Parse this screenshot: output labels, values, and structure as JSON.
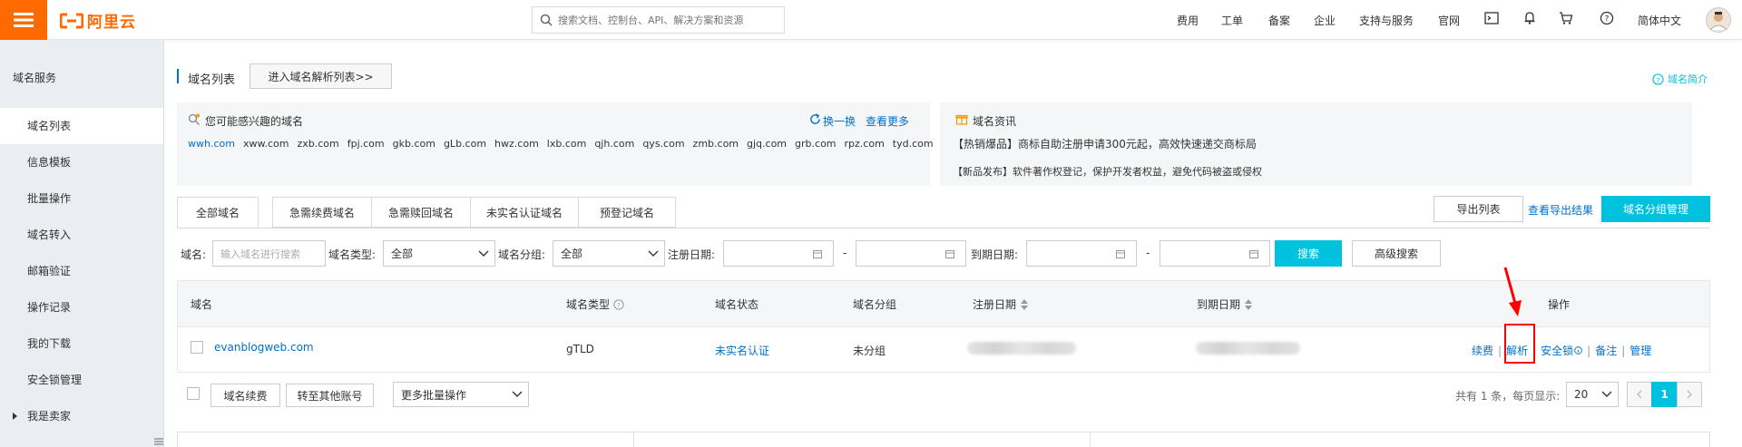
{
  "topbar": {
    "logo_text": "阿里云",
    "search_placeholder": "搜索文档、控制台、API、解决方案和资源",
    "nav": [
      "费用",
      "工单",
      "备案",
      "企业",
      "支持与服务",
      "官网"
    ],
    "language": "简体中文"
  },
  "sidebar": {
    "title": "域名服务",
    "items": [
      {
        "label": "域名列表"
      },
      {
        "label": "信息模板"
      },
      {
        "label": "批量操作"
      },
      {
        "label": "域名转入"
      },
      {
        "label": "邮箱验证"
      },
      {
        "label": "操作记录"
      },
      {
        "label": "我的下载"
      },
      {
        "label": "安全锁管理"
      },
      {
        "label": "我是卖家"
      }
    ]
  },
  "header": {
    "title": "域名列表",
    "resolve_list_button": "进入域名解析列表>>",
    "intro_link": "域名简介"
  },
  "suggest_panel": {
    "title": "您可能感兴趣的域名",
    "refresh": "换一换",
    "more": "查看更多",
    "domains": [
      "wwh.com",
      "xww.com",
      "zxb.com",
      "fpj.com",
      "gkb.com",
      "gLb.com",
      "hwz.com",
      "lxb.com",
      "qjh.com",
      "qys.com",
      "zmb.com",
      "gjq.com",
      "grb.com",
      "rpz.com",
      "tyd.com"
    ]
  },
  "news_panel": {
    "title": "域名资讯",
    "items": [
      "【热销爆品】商标自助注册申请300元起，高效快速递交商标局",
      "【新品发布】软件著作权登记，保护开发者权益，避免代码被盗或侵权"
    ]
  },
  "tabs": [
    "全部域名",
    "急需续费域名",
    "急需赎回域名",
    "未实名认证域名",
    "预登记域名"
  ],
  "actions": {
    "export_list": "导出列表",
    "view_export": "查看导出结果",
    "group_manage": "域名分组管理"
  },
  "filters": {
    "domain_label": "域名:",
    "domain_placeholder": "输入域名进行搜索",
    "type_label": "域名类型:",
    "type_value": "全部",
    "group_label": "域名分组:",
    "group_value": "全部",
    "reg_date_label": "注册日期:",
    "exp_date_label": "到期日期:",
    "range_sep": "-",
    "search_button": "搜索",
    "advanced_button": "高级搜索"
  },
  "table": {
    "columns": [
      "域名",
      "域名类型",
      "域名状态",
      "域名分组",
      "注册日期",
      "到期日期",
      "操作"
    ],
    "rows": [
      {
        "domain": "evanblogweb.com",
        "type": "gTLD",
        "status": "未实名认证",
        "group": "未分组",
        "ops": [
          "续费",
          "解析",
          "安全锁",
          "备注",
          "管理"
        ]
      }
    ]
  },
  "footer": {
    "renew_button": "域名续费",
    "transfer_button": "转至其他账号",
    "batch_select": "更多批量操作",
    "summary": "共有 1 条，每页显示:",
    "page_size": "20",
    "current_page": "1"
  },
  "colors": {
    "brand": "#ff6a00",
    "accent": "#00c1de",
    "link": "#0070cc",
    "highlight": "#ff0000"
  }
}
